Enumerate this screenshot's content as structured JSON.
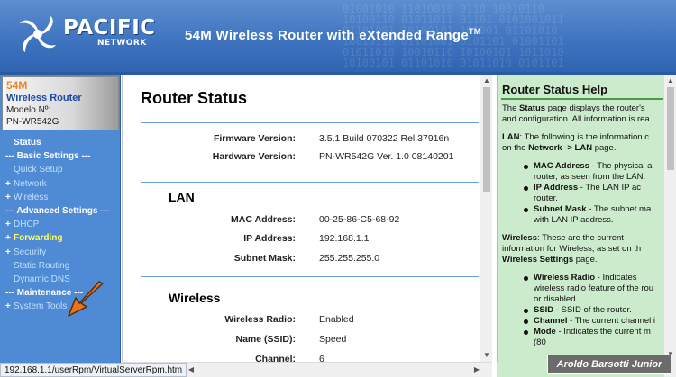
{
  "header": {
    "brand": "PACIFIC",
    "brand_sub": "NETWORK",
    "title": "54M Wireless Router with eXtended Range",
    "title_mark": "TM"
  },
  "device": {
    "model_speed": "54M",
    "name": "Wireless Router",
    "model_label": "Modelo Nº:",
    "model_code": "PN-WR542G"
  },
  "menu": [
    {
      "label": "Status",
      "kind": "status"
    },
    {
      "label": "--- Basic Settings ---",
      "kind": "header"
    },
    {
      "label": "Quick Setup",
      "kind": "link"
    },
    {
      "label": "Network",
      "kind": "plus"
    },
    {
      "label": "Wireless",
      "kind": "plus"
    },
    {
      "label": "--- Advanced Settings ---",
      "kind": "header"
    },
    {
      "label": "DHCP",
      "kind": "plus"
    },
    {
      "label": "Forwarding",
      "kind": "active"
    },
    {
      "label": "Security",
      "kind": "plus"
    },
    {
      "label": "Static Routing",
      "kind": "link"
    },
    {
      "label": "Dynamic DNS",
      "kind": "link"
    },
    {
      "label": "--- Maintenance ---",
      "kind": "header"
    },
    {
      "label": "System Tools",
      "kind": "plus"
    }
  ],
  "main": {
    "title": "Router Status",
    "firmware_label": "Firmware Version:",
    "firmware_value": "3.5.1 Build 070322 Rel.37916n",
    "hardware_label": "Hardware Version:",
    "hardware_value": "PN-WR542G Ver. 1.0 08140201",
    "lan": {
      "title": "LAN",
      "mac_label": "MAC Address:",
      "mac_value": "00-25-86-C5-68-92",
      "ip_label": "IP Address:",
      "ip_value": "192.168.1.1",
      "mask_label": "Subnet Mask:",
      "mask_value": "255.255.255.0"
    },
    "wireless": {
      "title": "Wireless",
      "radio_label": "Wireless Radio:",
      "radio_value": "Enabled",
      "ssid_label": "Name (SSID):",
      "ssid_value": "Speed",
      "channel_label": "Channel:",
      "channel_value": "6"
    }
  },
  "help": {
    "title": "Router Status Help",
    "intro_1a": "The ",
    "intro_1b": "Status",
    "intro_1c": " page displays the router's",
    "intro_2": "and configuration. All information is rea",
    "lan_1a": "LAN",
    "lan_1b": ": The following is the information c",
    "lan_2a": "on the ",
    "lan_2b": "Network -> LAN",
    "lan_2c": " page.",
    "lan_items": [
      {
        "name": "MAC Address",
        "rest": " - The physical a",
        "cont": "router, as seen from the LAN."
      },
      {
        "name": "IP Address",
        "rest": " - The LAN IP ac",
        "cont": "router."
      },
      {
        "name": "Subnet Mask",
        "rest": " - The subnet ma",
        "cont": "with LAN IP address."
      }
    ],
    "wl_1a": "Wireless",
    "wl_1b": ":  These  are  the  current",
    "wl_2": "information for Wireless, as set on th",
    "wl_3a": "Wireless Settings",
    "wl_3b": " page.",
    "wl_items": [
      {
        "name": "Wireless Radio",
        "rest": " - Indicates",
        "cont": "wireless radio feature of the rou",
        "cont2": "or disabled."
      },
      {
        "name": "SSID",
        "rest": " - SSID of the router.",
        "cont": "",
        "cont2": ""
      },
      {
        "name": "Channel",
        "rest": " - The current channel i",
        "cont": "",
        "cont2": ""
      },
      {
        "name": "Mode",
        "rest": " - Indicates the current m",
        "cont": "(80",
        "cont2": ""
      }
    ]
  },
  "status_url": "192.168.1.1/userRpm/VirtualServerRpm.htm",
  "watermark": "Aroldo Barsotti Junior",
  "colors": {
    "header_blue": "#3f74c0",
    "nav_blue": "#4f8ad4",
    "help_green": "#ccebcc",
    "active_yellow": "#ffff66",
    "arrow_orange": "#e8731c"
  }
}
